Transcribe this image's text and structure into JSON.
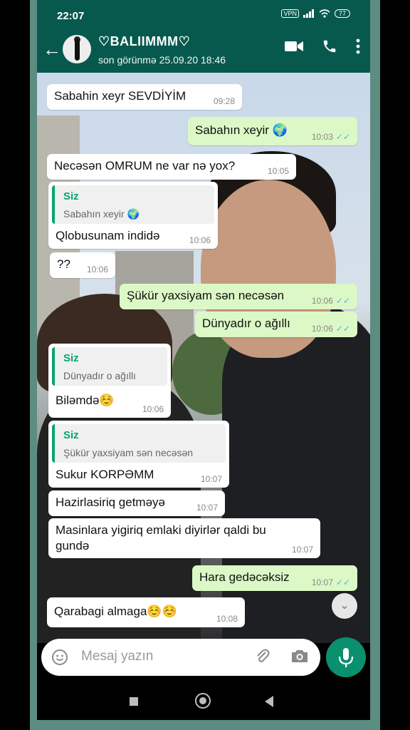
{
  "status_bar": {
    "time": "22:07",
    "vpn": "VPN",
    "battery": "77"
  },
  "header": {
    "contact_name": "♡BALIIMMM♡",
    "last_seen": "son görünmə 25.09.20 18:46",
    "back_icon": "arrow-left-icon",
    "video_icon": "video-call-icon",
    "call_icon": "phone-icon",
    "menu_icon": "more-vertical-icon"
  },
  "messages": [
    {
      "dir": "in",
      "text": "Sabahin xeyr SEVDİYİM",
      "time": "09:28"
    },
    {
      "dir": "out",
      "text": "Sabahın xeyir 🌍",
      "time": "10:03"
    },
    {
      "dir": "in",
      "text": "Necəsən OMRUM ne var nə yox?",
      "time": "10:05"
    },
    {
      "dir": "in",
      "quote_name": "Siz",
      "quote_text": "Sabahın xeyir 🌍",
      "text": "Qlobusunam indidə",
      "time": "10:06"
    },
    {
      "dir": "in",
      "text": "??",
      "time": "10:06"
    },
    {
      "dir": "out",
      "text": "Şükür yaxsiyam sən necəsən",
      "time": "10:06"
    },
    {
      "dir": "out",
      "text": "Dünyadır o ağıllı",
      "time": "10:06"
    },
    {
      "dir": "in",
      "quote_name": "Siz",
      "quote_text": "Dünyadır o ağıllı",
      "text": "Biləmdə☺️",
      "time": "10:06"
    },
    {
      "dir": "in",
      "quote_name": "Siz",
      "quote_text": "Şükür yaxsiyam sən necəsən",
      "text": "Sukur KORPƏMM",
      "time": "10:07"
    },
    {
      "dir": "in",
      "text": "Hazirlasiriq getməyə",
      "time": "10:07"
    },
    {
      "dir": "in",
      "text": "Masinlara yigiriq emlaki diyirlər qaldi bu",
      "text2": "gundə",
      "time": "10:07"
    },
    {
      "dir": "out",
      "text": "Hara gedəcəksiz",
      "time": "10:07"
    },
    {
      "dir": "in",
      "text": "Qarabagi almaga☺️☺️",
      "time": "10:08"
    }
  ],
  "input": {
    "placeholder": "Mesaj yazın",
    "emoji_icon": "emoji-icon",
    "attach_icon": "paperclip-icon",
    "camera_icon": "camera-icon",
    "mic_icon": "microphone-icon"
  },
  "read_receipt": "✓✓",
  "colors": {
    "header": "#07594d",
    "outgoing": "#dcf8c6",
    "incoming": "#ffffff",
    "accent": "#0a8f6f",
    "read_ticks": "#4fb6ec"
  }
}
